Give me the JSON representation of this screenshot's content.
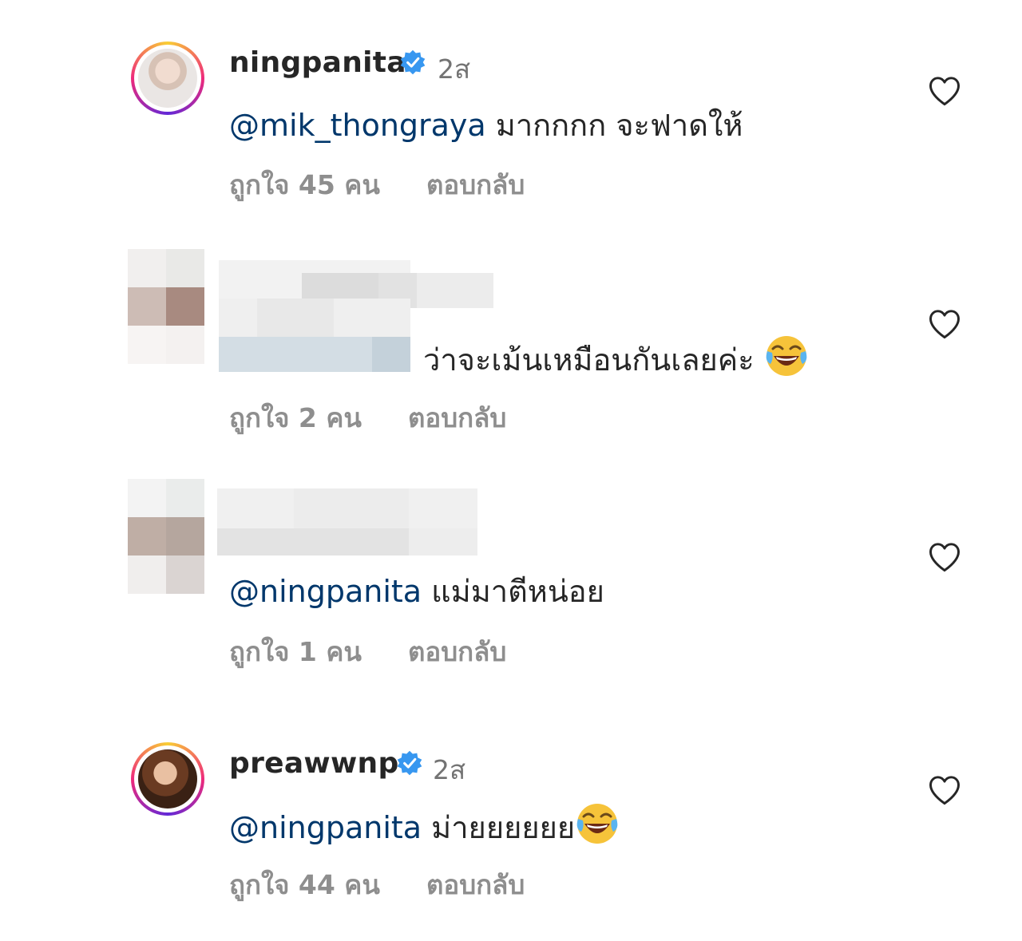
{
  "comments": [
    {
      "username": "ningpanita",
      "verified": true,
      "time": "2ส",
      "mention": "@mik_thongraya",
      "text": " มากกกก จะฟาดให้",
      "likes": "ถูกใจ 45 คน",
      "reply": "ตอบกลับ"
    },
    {
      "username": "",
      "verified": false,
      "time": "",
      "mention": "",
      "text": "ว่าจะเม้นเหมือนกันเลยค่ะ",
      "emoji": "face-with-tears-of-joy",
      "likes": "ถูกใจ 2 คน",
      "reply": "ตอบกลับ"
    },
    {
      "username": "",
      "verified": false,
      "time": "",
      "mention": "@ningpanita",
      "text": " แม่มาตีหน่อย",
      "likes": "ถูกใจ 1 คน",
      "reply": "ตอบกลับ"
    },
    {
      "username": "preawwnp",
      "verified": true,
      "time": "2ส",
      "mention": "@ningpanita",
      "text": " ม่ายยยยยย",
      "emoji": "face-with-tears-of-joy",
      "likes": "ถูกใจ 44 คน",
      "reply": "ตอบกลับ"
    }
  ],
  "colors": {
    "mention": "#00376b",
    "verified": "#3797f0",
    "meta": "#8e8e8e",
    "text": "#262626"
  }
}
